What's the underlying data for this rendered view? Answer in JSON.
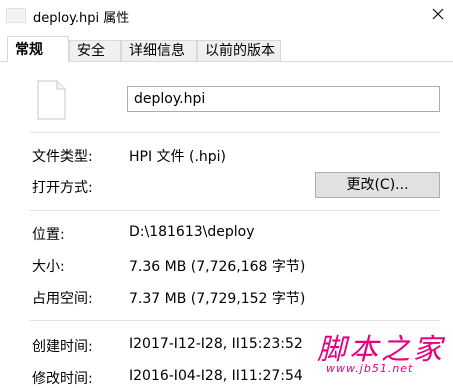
{
  "window": {
    "title": "deploy.hpi 属性"
  },
  "tabs": [
    {
      "label": "常规",
      "active": true
    },
    {
      "label": "安全",
      "active": false
    },
    {
      "label": "详细信息",
      "active": false
    },
    {
      "label": "以前的版本",
      "active": false
    }
  ],
  "general": {
    "file_name": "deploy.hpi",
    "type_label": "文件类型:",
    "type_value": "HPI 文件 (.hpi)",
    "opens_with_label": "打开方式:",
    "change_button": "更改(C)...",
    "location_label": "位置:",
    "location_value": "D:\\181613\\deploy",
    "size_label": "大小:",
    "size_value": "7.36 MB (7,726,168 字节)",
    "size_on_disk_label": "占用空间:",
    "size_on_disk_value": "7.37 MB (7,729,152 字节)",
    "created_label": "创建时间:",
    "created_value": "I2017-I12-I28, II15:23:52",
    "modified_label": "修改时间:",
    "modified_value": "I2016-I04-I28, II11:27:54"
  },
  "watermark": {
    "text": "脚本之家",
    "url": "www.jb51.net"
  },
  "colors": {
    "watermark": "#e4007f",
    "tab_border": "#d9d9d9",
    "button_bg": "#e1e1e1"
  }
}
